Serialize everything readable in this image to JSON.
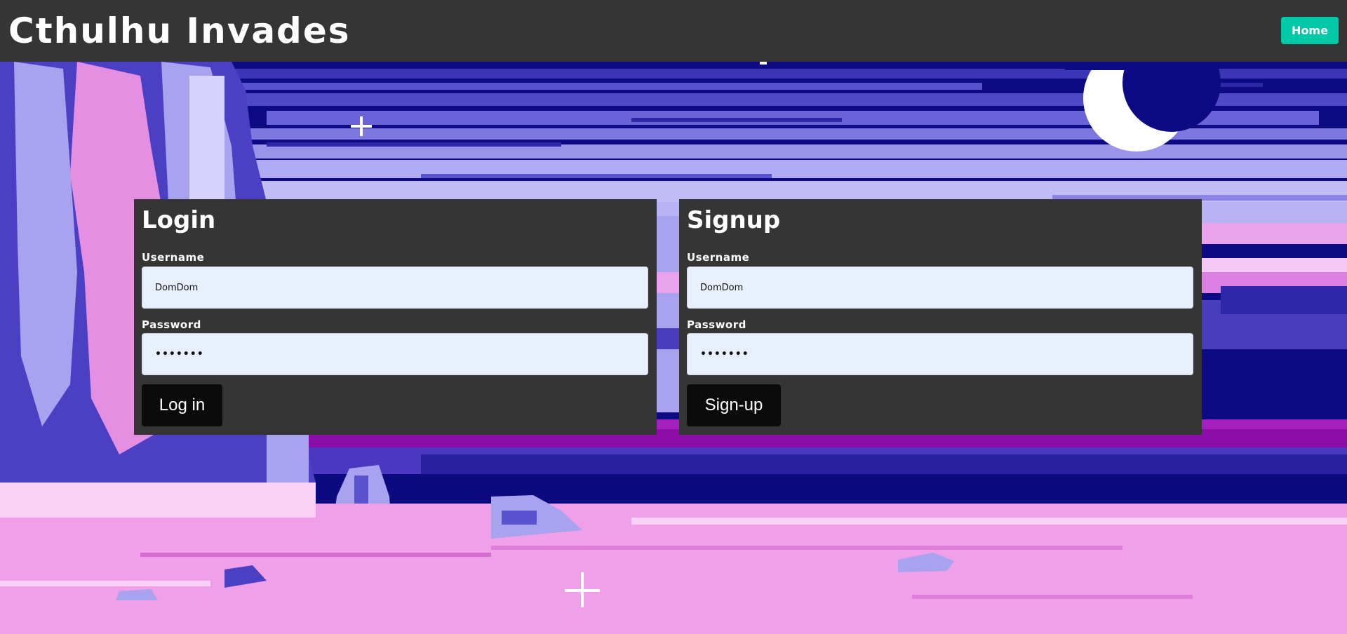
{
  "header": {
    "title": "Cthulhu Invades",
    "home_label": "Home"
  },
  "login": {
    "title": "Login",
    "username_label": "Username",
    "username_value": "DomDom",
    "password_label": "Password",
    "password_value": "•••••••",
    "submit_label": "Log in"
  },
  "signup": {
    "title": "Signup",
    "username_label": "Username",
    "username_value": "DomDom",
    "password_label": "Password",
    "password_value": "•••••••",
    "submit_label": "Sign-up"
  },
  "colors": {
    "header_bg": "#353535",
    "accent": "#00c9a7",
    "card_bg": "#353535",
    "input_bg": "#e8f0fe",
    "button_bg": "#0b0b0b"
  }
}
